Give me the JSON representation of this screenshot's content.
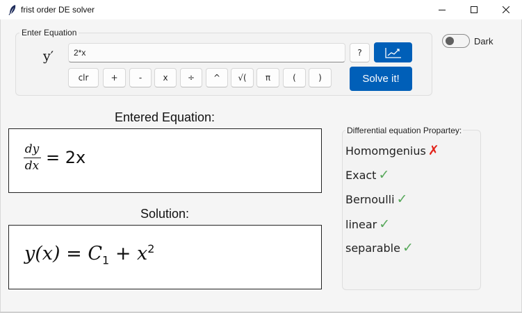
{
  "window": {
    "title": "frist order DE solver",
    "app_icon": "feather-icon"
  },
  "equation_frame": {
    "label": "Enter Equation",
    "prefix": "y′",
    "input_value": "2*x",
    "help_label": "?",
    "plot_icon": "chart-trend-icon",
    "solve_label": "Solve it!",
    "keypad": [
      "clr",
      "+",
      "-",
      "x",
      "÷",
      "^",
      "√(",
      "π",
      "(",
      ")"
    ]
  },
  "theme": {
    "dark_label": "Dark",
    "dark_enabled": false,
    "accent_color": "#005fb8"
  },
  "entered": {
    "heading": "Entered Equation:",
    "numerator": "dy",
    "denominator": "dx",
    "rhs": "= 2x"
  },
  "solution": {
    "heading": "Solution:",
    "lhs": "y(x)",
    "equals": "=",
    "constant": "C",
    "constant_sub": "1",
    "plus": "+",
    "var": "x",
    "exp": "2"
  },
  "properties": {
    "title": "Differential equation Propartey:",
    "items": [
      {
        "label": "Homomgenius",
        "mark": "✗",
        "ok": false
      },
      {
        "label": "Exact",
        "mark": "✓",
        "ok": true
      },
      {
        "label": "Bernoulli",
        "mark": "✓",
        "ok": true
      },
      {
        "label": "linear",
        "mark": "✓",
        "ok": true
      },
      {
        "label": "separable",
        "mark": "✓",
        "ok": true
      }
    ],
    "yes_color": "#57a85a",
    "no_color": "#e2231a"
  }
}
